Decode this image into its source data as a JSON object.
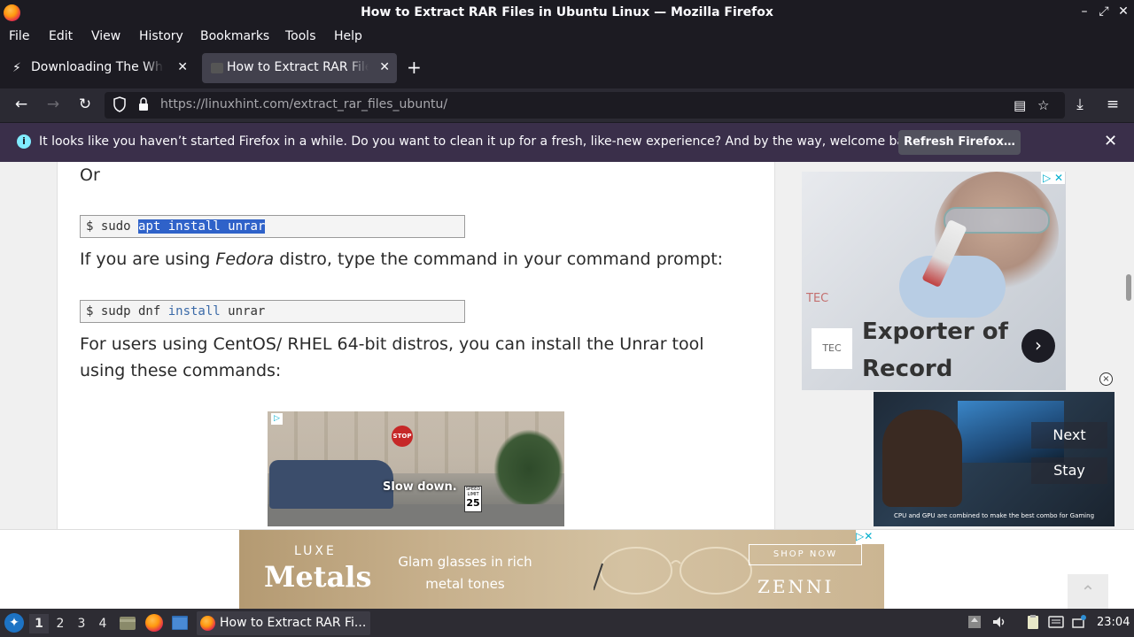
{
  "window": {
    "title": "How to Extract RAR Files in Ubuntu Linux — Mozilla Firefox",
    "controls": [
      "–",
      "⤢",
      "✕"
    ]
  },
  "menubar": [
    "File",
    "Edit",
    "View",
    "History",
    "Bookmarks",
    "Tools",
    "Help"
  ],
  "tabs": [
    {
      "label": "Downloading The White House",
      "close": "✕",
      "icon": "lightning-icon"
    },
    {
      "label": "How to Extract RAR Files in Ubuntu Linux",
      "close": "✕",
      "icon": "linuxhint-favicon",
      "active": true
    }
  ],
  "newtab": "+",
  "nav": {
    "back": "←",
    "forward": "→",
    "reload": "↻",
    "url_host": "https://linuxhint.com",
    "url_path": "/extract_rar_files_ubuntu/",
    "reader": "▤",
    "bookmark": "☆",
    "download": "⤓",
    "menu": "≡"
  },
  "notification": {
    "icon": "i",
    "message": "It looks like you haven’t started Firefox in a while. Do you want to clean it up for a fresh, like-new experience? And by the way, welcome back!",
    "button": "Refresh Firefox…",
    "close": "✕"
  },
  "article": {
    "or": "Or",
    "cmd1_prefix": "$ sudo ",
    "cmd1_selected": "apt install unrar",
    "fedora_pre": "If you are using ",
    "fedora_em": "Fedora",
    "fedora_post": " distro, type the command in your command prompt:",
    "cmd2_prefix": "$ sudp dnf ",
    "cmd2_kw": "install",
    "cmd2_suffix": " unrar",
    "centos": "For users using CentOS/ RHEL 64-bit distros, you can install the Unrar tool using these commands:"
  },
  "inline_ad": {
    "text": "Slow down.",
    "stop": "STOP",
    "sign_top": "SPEED LIMIT",
    "sign_num": "25",
    "adchoice": "▷"
  },
  "side_ad": {
    "brand_small": "TEC",
    "logo": "TEC",
    "headline_1": "Exporter of",
    "headline_2": "Record",
    "arrow": "›",
    "adchoice": "▷ ✕"
  },
  "video_ad": {
    "caption": "CPU and GPU are combined to make the best combo for Gaming",
    "next": "Next",
    "stay": "Stay",
    "close": "×"
  },
  "bottom_ad": {
    "luxe": "LUXE",
    "metals": "Metals",
    "tagline": "Glam glasses in rich metal tones",
    "shop": "SHOP NOW",
    "brand": "ZENNI",
    "adchoice": "▷✕"
  },
  "to_top": "⌃",
  "taskbar": {
    "start": "✦",
    "workspaces": [
      "1",
      "2",
      "3",
      "4"
    ],
    "window_label": "How to Extract RAR Fi...",
    "clock": "23:04"
  }
}
